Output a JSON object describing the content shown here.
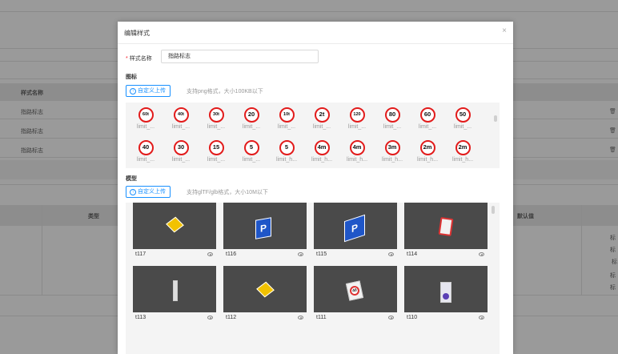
{
  "background": {
    "table": {
      "header": "样式名称",
      "rows": [
        "指路标志",
        "指路标志",
        "指路标志"
      ],
      "delete_glyph": "🗑"
    },
    "lower_table": {
      "col_type": "类型",
      "col_default": "默认值",
      "side_chars": [
        "标",
        "标",
        "标",
        "标",
        "标"
      ]
    }
  },
  "modal": {
    "title": "编辑样式",
    "close_glyph": "×",
    "name_label": "样式名称",
    "name_required": "*",
    "name_value": "指路标志",
    "icon_section": {
      "title": "图标",
      "upload_label": "自定义上传",
      "hint": "支持png格式，大小100KB以下",
      "icons": [
        {
          "text": "60t",
          "label": "limit_..."
        },
        {
          "text": "40t",
          "label": "limit_..."
        },
        {
          "text": "30t",
          "label": "limit_..."
        },
        {
          "text": "20",
          "label": "limit_..."
        },
        {
          "text": "10t",
          "label": "limit_..."
        },
        {
          "text": "2t",
          "label": "limit_..."
        },
        {
          "text": "120",
          "label": "limit_..."
        },
        {
          "text": "80",
          "label": "limit_..."
        },
        {
          "text": "60",
          "label": "limit_..."
        },
        {
          "text": "50",
          "label": "limit_..."
        },
        {
          "text": "40",
          "label": "limit_..."
        },
        {
          "text": "30",
          "label": "limit_..."
        },
        {
          "text": "15",
          "label": "limit_..."
        },
        {
          "text": "5",
          "label": "limit_..."
        },
        {
          "text": "5",
          "label": "limit_h..."
        },
        {
          "text": "4m",
          "label": "limit_h..."
        },
        {
          "text": "4m",
          "label": "limit_h..."
        },
        {
          "text": "3m",
          "label": "limit_h..."
        },
        {
          "text": "2m",
          "label": "limit_h..."
        },
        {
          "text": "2m",
          "label": "limit_h..."
        }
      ]
    },
    "model_section": {
      "title": "模型",
      "upload_label": "自定义上传",
      "hint": "支持glTF/glb格式，大小10M以下",
      "models": [
        {
          "name": "t117"
        },
        {
          "name": "t116"
        },
        {
          "name": "t115"
        },
        {
          "name": "t114"
        },
        {
          "name": "t113"
        },
        {
          "name": "t112"
        },
        {
          "name": "t111"
        },
        {
          "name": "t110"
        }
      ],
      "model_glyphs": {
        "p": "P",
        "speed": "40"
      }
    }
  },
  "colors": {
    "primary": "#1890ff",
    "sign_red": "#e21b1b",
    "thumb_bg": "#4a4a4a",
    "overlay": "#9a9a9a"
  }
}
